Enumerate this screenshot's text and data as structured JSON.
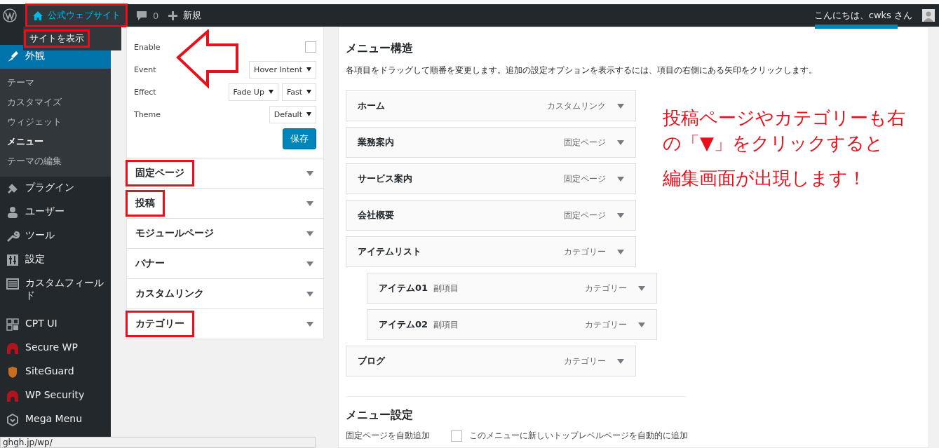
{
  "admin_bar": {
    "site": {
      "label": "公式ウェブサイト",
      "highlighted": true
    },
    "site_menu": [
      {
        "label": "サイトを表示",
        "highlighted": true
      }
    ],
    "comments": "0",
    "new": "新規",
    "greeting": "こんにちは、cwks さん"
  },
  "sidebar": {
    "items": [
      {
        "label": "外観",
        "selected": true,
        "children": [
          {
            "label": "テーマ",
            "selected": false
          },
          {
            "label": "カスタマイズ",
            "selected": false
          },
          {
            "label": "ウィジェット",
            "selected": false
          },
          {
            "label": "メニュー",
            "selected": true
          },
          {
            "label": "テーマの編集",
            "selected": false
          }
        ]
      },
      {
        "label": "プラグイン",
        "selected": false
      },
      {
        "label": "ユーザー",
        "selected": false
      },
      {
        "label": "ツール",
        "selected": false
      },
      {
        "label": "設定",
        "selected": false
      },
      {
        "label": "カスタムフィールド",
        "selected": false
      },
      {
        "label": "CPT UI",
        "selected": false
      },
      {
        "label": "Secure WP",
        "selected": false
      },
      {
        "label": "SiteGuard",
        "selected": false
      },
      {
        "label": "WP Security",
        "selected": false
      },
      {
        "label": "Mega Menu",
        "selected": false
      }
    ]
  },
  "mega_menu_settings": {
    "fields": [
      {
        "kind": "checkbox",
        "label": "Enable",
        "checked": false
      },
      {
        "kind": "select",
        "label": "Event",
        "values": [
          "Hover Intent"
        ]
      },
      {
        "kind": "select",
        "label": "Effect",
        "values": [
          "Fade Up",
          "Fast"
        ]
      },
      {
        "kind": "select",
        "label": "Theme",
        "values": [
          "Default"
        ]
      }
    ],
    "save_button": "保存"
  },
  "sections": [
    {
      "label": "固定ページ",
      "highlighted": true
    },
    {
      "label": "投稿",
      "highlighted": true
    },
    {
      "label": "モジュールページ",
      "highlighted": false
    },
    {
      "label": "バナー",
      "highlighted": false
    },
    {
      "label": "カスタムリンク",
      "highlighted": false
    },
    {
      "label": "カテゴリー",
      "highlighted": true
    }
  ],
  "menu_structure": {
    "title": "メニュー構造",
    "description": "各項目をドラッグして順番を変更します。追加の設定オプションを表示するには、項目の右側にある矢印をクリックします。",
    "items": [
      {
        "title": "ホーム",
        "type": "カスタムリンク"
      },
      {
        "title": "業務案内",
        "type": "固定ページ"
      },
      {
        "title": "サービス案内",
        "type": "固定ページ"
      },
      {
        "title": "会社概要",
        "type": "固定ページ"
      },
      {
        "title": "アイテムリスト",
        "type": "カテゴリー",
        "children": [
          {
            "title": "アイテム01",
            "note": "副項目",
            "type": "カテゴリー"
          },
          {
            "title": "アイテム02",
            "note": "副項目",
            "type": "カテゴリー"
          }
        ]
      },
      {
        "title": "ブログ",
        "type": "カテゴリー"
      }
    ]
  },
  "menu_settings": {
    "title": "メニュー設定",
    "rows": [
      {
        "label": "固定ページを自動追加",
        "checked": false,
        "option": "このメニューに新しいトップレベルページを自動的に追加"
      }
    ]
  },
  "status_url": "ghgh.jp/wp/",
  "annotation": {
    "lines": [
      "投稿ページやカテゴリーも右の「▼」をクリックすると",
      "編集画面が出現します！"
    ]
  }
}
